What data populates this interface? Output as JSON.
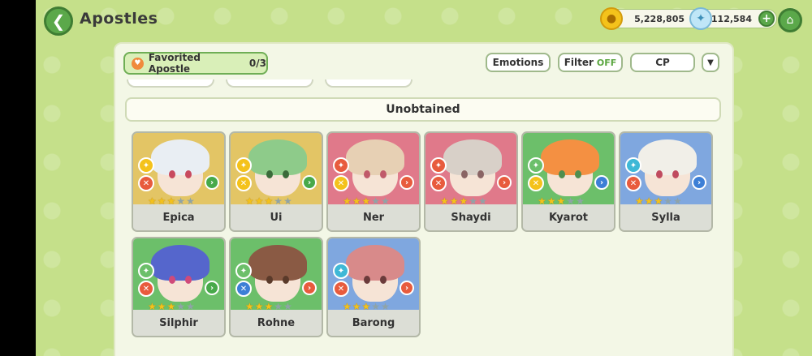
{
  "header": {
    "title": "Apostles",
    "gold_amount": "5,228,805",
    "gem_amount": "112,584"
  },
  "toolbar": {
    "favorited_label": "Favorited Apostle",
    "favorited_count": "0/3",
    "emotions_label": "Emotions",
    "filter_label": "Filter",
    "filter_state": "OFF",
    "cp_label": "CP",
    "expand_icon": "double-chevron-down-icon"
  },
  "section": {
    "title": "Unobtained"
  },
  "apostles": [
    {
      "name": "Epica",
      "bg": "#e3c565",
      "hair": "#e9eef3",
      "eye": "#c84a5e",
      "elem_top": "#f4c21b",
      "elem_bot": "#e85b3d",
      "class_color": "#47a94a",
      "stars": 3
    },
    {
      "name": "Ui",
      "bg": "#e3c565",
      "hair": "#8ecb8a",
      "eye": "#3b6b3a",
      "elem_top": "#f4c21b",
      "elem_bot": "#f4c21b",
      "class_color": "#47a94a",
      "stars": 3
    },
    {
      "name": "Ner",
      "bg": "#e0798a",
      "hair": "#e7d0b4",
      "eye": "#c05a6a",
      "elem_top": "#e85b3d",
      "elem_bot": "#f4c21b",
      "class_color": "#e85b3d",
      "stars": 3
    },
    {
      "name": "Shaydi",
      "bg": "#e0798a",
      "hair": "#d8d0c8",
      "eye": "#8a6464",
      "elem_top": "#e85b3d",
      "elem_bot": "#e85b3d",
      "class_color": "#e85b3d",
      "stars": 3
    },
    {
      "name": "Kyarot",
      "bg": "#6cbf6a",
      "hair": "#f49042",
      "eye": "#4f8e4f",
      "elem_top": "#6cbf6a",
      "elem_bot": "#f4c21b",
      "class_color": "#3d7fd6",
      "stars": 3
    },
    {
      "name": "Sylla",
      "bg": "#7fa7df",
      "hair": "#f1efe8",
      "eye": "#c04b5f",
      "elem_top": "#3fb8d6",
      "elem_bot": "#e85b3d",
      "class_color": "#3d7fd6",
      "stars": 3
    },
    {
      "name": "Silphir",
      "bg": "#6cbf6a",
      "hair": "#5566cc",
      "eye": "#d04a7a",
      "elem_top": "#6cbf6a",
      "elem_bot": "#e85b3d",
      "class_color": "#47a94a",
      "stars": 3
    },
    {
      "name": "Rohne",
      "bg": "#6cbf6a",
      "hair": "#8a5a44",
      "eye": "#5a3a2a",
      "elem_top": "#6cbf6a",
      "elem_bot": "#3d7fd6",
      "class_color": "#e85b3d",
      "stars": 3
    },
    {
      "name": "Barong",
      "bg": "#7fa7df",
      "hair": "#d88a8a",
      "eye": "#6b3b3b",
      "elem_top": "#3fb8d6",
      "elem_bot": "#e85b3d",
      "class_color": "#e85b3d",
      "stars": 3
    }
  ]
}
